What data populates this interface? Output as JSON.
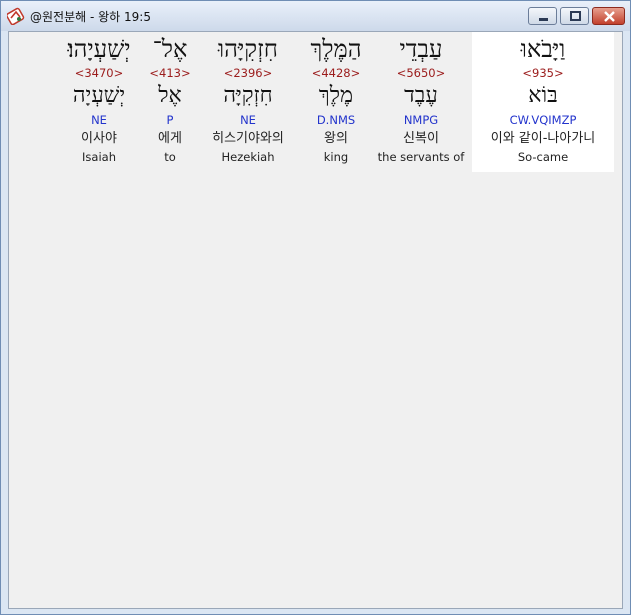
{
  "window": {
    "title": "@원전분해 - 왕하 19:5",
    "buttons": [
      "minimize",
      "maximize",
      "close"
    ]
  },
  "words": [
    {
      "hebrew": "וַיָּבֹאוּ",
      "strong": "<935>",
      "lemma": "בּוֹא",
      "morph": "CW.VQIMZP",
      "korean": "이와 같이-나아가니",
      "english": "So-came",
      "selected": true
    },
    {
      "hebrew": "עַבְדֵי",
      "strong": "<5650>",
      "lemma": "עֶבֶד",
      "morph": "NMPG",
      "korean": "신복이",
      "english": "the servants of",
      "selected": false
    },
    {
      "hebrew": "הַמֶּלֶךְ",
      "strong": "<4428>",
      "lemma": "מֶלֶךְ",
      "morph": "D.NMS",
      "korean": "왕의",
      "english": "king",
      "selected": false
    },
    {
      "hebrew": "חִזְקִיָּהוּ",
      "strong": "<2396>",
      "lemma": "חִזְקִיָּה",
      "morph": "NE",
      "korean": "히스기야와의",
      "english": "Hezekiah",
      "selected": false
    },
    {
      "hebrew": "אֶל־",
      "strong": "<413>",
      "lemma": "אֶל",
      "morph": "P",
      "korean": "에게",
      "english": "to",
      "selected": false
    },
    {
      "hebrew": "יְשַׁעְיָהוּ׃",
      "strong": "<3470>",
      "lemma": "יְשַׁעְיָה",
      "morph": "NE",
      "korean": "이사야",
      "english": "Isaiah",
      "selected": false
    }
  ]
}
